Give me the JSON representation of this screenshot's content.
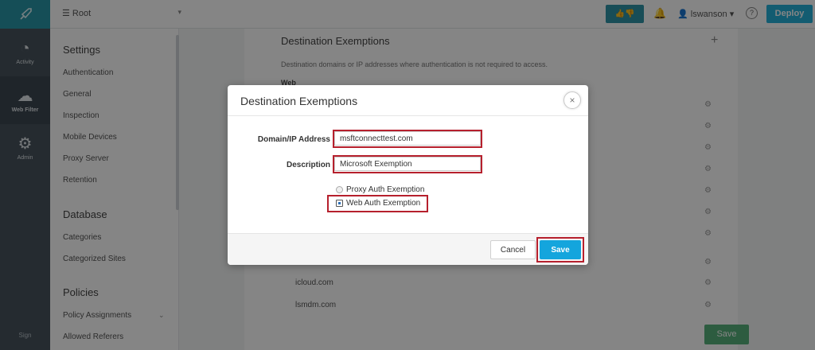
{
  "header": {
    "root_label": "Root",
    "user_label": "lswanson",
    "deploy_label": "Deploy",
    "help_label": "?"
  },
  "rail": {
    "items": [
      {
        "label": "Activity",
        "icon": "pie-chart-icon"
      },
      {
        "label": "Web Filter",
        "icon": "cloud-icon"
      },
      {
        "label": "Admin",
        "icon": "gear-icon"
      }
    ],
    "footer": "Sign"
  },
  "sidebar": {
    "settings_title": "Settings",
    "settings_items": [
      "Authentication",
      "General",
      "Inspection",
      "Mobile Devices",
      "Proxy Server",
      "Retention"
    ],
    "database_title": "Database",
    "database_items": [
      "Categories",
      "Categorized Sites"
    ],
    "policies_title": "Policies",
    "policies_items": [
      "Policy Assignments",
      "Allowed Referers"
    ]
  },
  "content": {
    "title": "Destination Exemptions",
    "description": "Destination domains or IP addresses where authentication is not required to access.",
    "web_heading": "Web",
    "rows": [
      "icloud.com",
      "lsmdm.com"
    ],
    "save_label": "Save"
  },
  "modal": {
    "title": "Destination Exemptions",
    "close_symbol": "×",
    "domain_label": "Domain/IP Address",
    "domain_value": "msftconnecttest.com",
    "description_label": "Description",
    "description_value": "Microsoft Exemption",
    "radio_proxy": "Proxy Auth Exemption",
    "radio_web": "Web Auth Exemption",
    "cancel_label": "Cancel",
    "save_label": "Save"
  },
  "colors": {
    "accent": "#14a5dd",
    "highlight": "#b6202d",
    "rail": "#47535d"
  }
}
